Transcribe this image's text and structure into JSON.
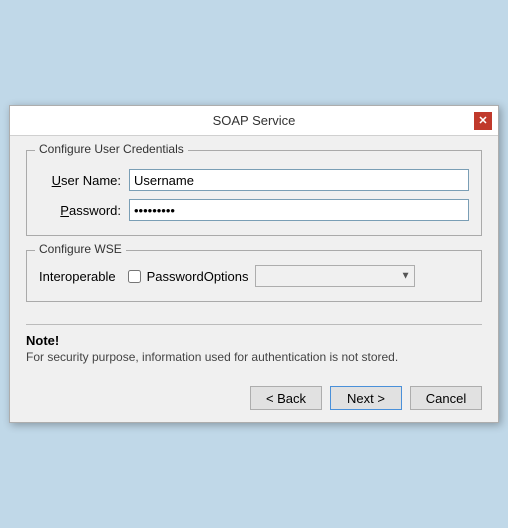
{
  "window": {
    "title": "SOAP Service",
    "close_label": "✕"
  },
  "credentials_group": {
    "legend": "Configure User Credentials",
    "username_label": "User Name:",
    "username_underline": "U",
    "username_value": "Username",
    "password_label": "Password:",
    "password_underline": "P",
    "password_value": "●●●●●●●●●"
  },
  "wse_group": {
    "legend": "Configure WSE",
    "interoperable_label": "Interoperable",
    "password_options_label": "PasswordOptions"
  },
  "note": {
    "title": "Note!",
    "text": "For security purpose, information used for authentication is not stored."
  },
  "buttons": {
    "back": "< Back",
    "next": "Next >",
    "cancel": "Cancel"
  }
}
